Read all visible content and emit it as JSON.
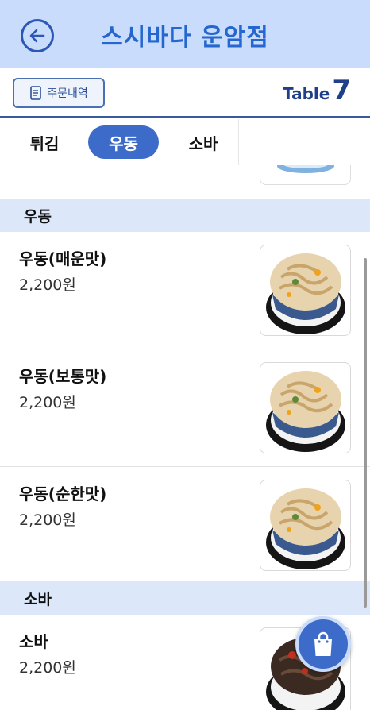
{
  "header": {
    "title": "스시바다 운암점",
    "back_icon": "back-arrow-icon"
  },
  "subbar": {
    "order_history_label": "주문내역",
    "order_icon": "receipt-icon",
    "table_word": "Table",
    "table_number": "7"
  },
  "tabs": [
    {
      "label": "튀김",
      "active": false
    },
    {
      "label": "우동",
      "active": true
    },
    {
      "label": "소바",
      "active": false
    }
  ],
  "sections": [
    {
      "title": "우동",
      "items": [
        {
          "name": "우동(매운맛)",
          "price": "2,200원"
        },
        {
          "name": "우동(보통맛)",
          "price": "2,200원"
        },
        {
          "name": "우동(순한맛)",
          "price": "2,200원"
        }
      ]
    },
    {
      "title": "소바",
      "items": [
        {
          "name": "소바",
          "price": "2,200원"
        }
      ]
    }
  ],
  "cart": {
    "icon": "shopping-bag-icon"
  },
  "colors": {
    "header_bg": "#c9dcfb",
    "accent": "#3d6bc9",
    "title": "#2566cf",
    "section_bg": "#dce8fa"
  }
}
